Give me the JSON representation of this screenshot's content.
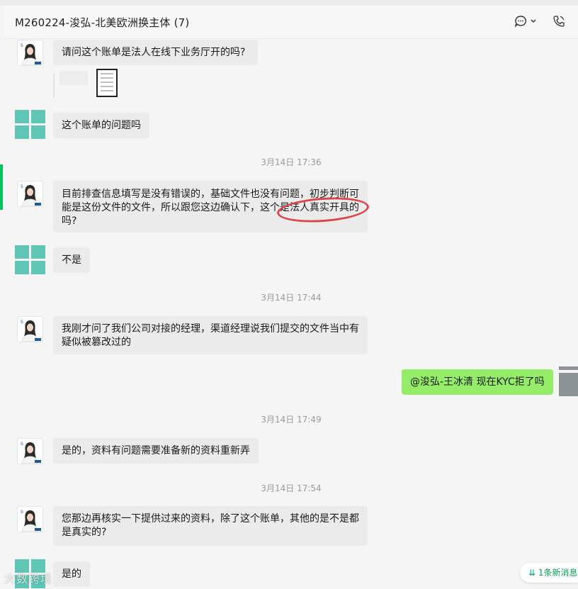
{
  "window": {
    "title": "M260224-浚弘-北美欧洲换主体 (7)"
  },
  "header": {
    "chat_icon": "chat-bubble-icon",
    "call_icon": "phone-icon"
  },
  "timestamps": [
    "3月14日 17:36",
    "3月14日 17:44",
    "3月14日 17:49",
    "3月14日 17:54"
  ],
  "messages": [
    {
      "from": "agent",
      "text": "请问这个账单是法人在线下业务厅开的吗?"
    },
    {
      "from": "group",
      "text": "这个账单的问题吗"
    },
    {
      "from": "agent",
      "text": "目前排查信息填写是没有错误的，基础文件也没有问题，初步判断可能是这份文件的文件，所以跟您这边确认下，这个是法人真实开具的吗?"
    },
    {
      "from": "group",
      "text": "不是"
    },
    {
      "from": "agent",
      "text": "我刚才问了我们公司对接的经理，渠道经理说我们提交的文件当中有疑似被篡改过的"
    },
    {
      "from": "me",
      "text": "@浚弘-王冰清 现在KYC拒了吗"
    },
    {
      "from": "agent",
      "text": "是的，资料有问题需要准备新的资料重新弄"
    },
    {
      "from": "agent",
      "text": "您那边再核实一下提供过来的资料，除了这个账单，其他的是不是都是真实的?"
    },
    {
      "from": "group",
      "text": "是的"
    }
  ],
  "new_message_badge": "1条新消息",
  "watermark": "大数跨境",
  "colors": {
    "accent_green": "#07c160",
    "my_bubble": "#95ec69",
    "other_bubble": "#ebebeb",
    "highlight_circle": "#d9474d"
  }
}
